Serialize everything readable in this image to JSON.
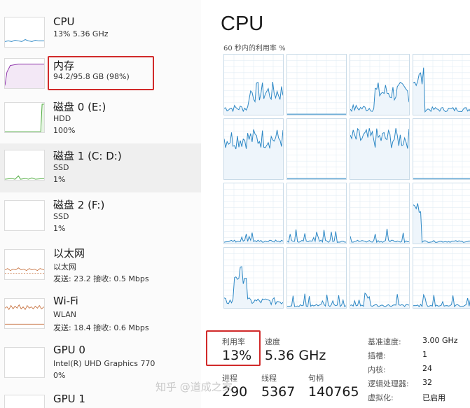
{
  "sidebar": {
    "items": [
      {
        "title": "CPU",
        "line1": "13%  5.36 GHz",
        "line2": "",
        "line3": "",
        "graph": "blue",
        "selected": false
      },
      {
        "title": "内存",
        "line1": "94.2/95.8 GB (98%)",
        "line2": "",
        "line3": "",
        "graph": "purple",
        "selected": false
      },
      {
        "title": "磁盘 0 (E:)",
        "line1": "HDD",
        "line2": "100%",
        "line3": "",
        "graph": "green",
        "selected": false
      },
      {
        "title": "磁盘 1 (C: D:)",
        "line1": "SSD",
        "line2": "1%",
        "line3": "",
        "graph": "green-low",
        "selected": true
      },
      {
        "title": "磁盘 2 (F:)",
        "line1": "SSD",
        "line2": "1%",
        "line3": "",
        "graph": "empty",
        "selected": false
      },
      {
        "title": "以太网",
        "line1": "以太网",
        "line2": "发送: 23.2  接收: 0.5 Mbps",
        "line3": "",
        "graph": "orange-low",
        "selected": false
      },
      {
        "title": "Wi-Fi",
        "line1": "WLAN",
        "line2": "发送: 18.4  接收: 0.6 Mbps",
        "line3": "",
        "graph": "orange",
        "selected": false
      },
      {
        "title": "GPU 0",
        "line1": "Intel(R) UHD Graphics 770",
        "line2": "0%",
        "line3": "",
        "graph": "empty",
        "selected": false
      },
      {
        "title": "GPU 1",
        "line1": "",
        "line2": "",
        "line3": "",
        "graph": "empty",
        "selected": false
      }
    ]
  },
  "main": {
    "title": "CPU",
    "graph_label": "60 秒内的利用率 %",
    "stats": {
      "utilization_label": "利用率",
      "utilization_value": "13%",
      "speed_label": "速度",
      "speed_value": "5.36 GHz",
      "processes_label": "进程",
      "processes_value": "290",
      "threads_label": "线程",
      "threads_value": "5367",
      "handles_label": "句柄",
      "handles_value": "140765"
    },
    "details": [
      {
        "key": "基准速度:",
        "value": "3.00 GHz"
      },
      {
        "key": "插槽:",
        "value": "1"
      },
      {
        "key": "内核:",
        "value": "24"
      },
      {
        "key": "逻辑处理器:",
        "value": "32"
      },
      {
        "key": "虚拟化:",
        "value": "已启用"
      }
    ]
  },
  "watermark": "知乎 @道成之家",
  "colors": {
    "cpu_line": "#2a86c4",
    "cpu_fill": "#eef5fb",
    "memory": "#8b2fa8",
    "disk": "#4daa3c",
    "network": "#c0622a",
    "highlight": "#d12a2a"
  }
}
